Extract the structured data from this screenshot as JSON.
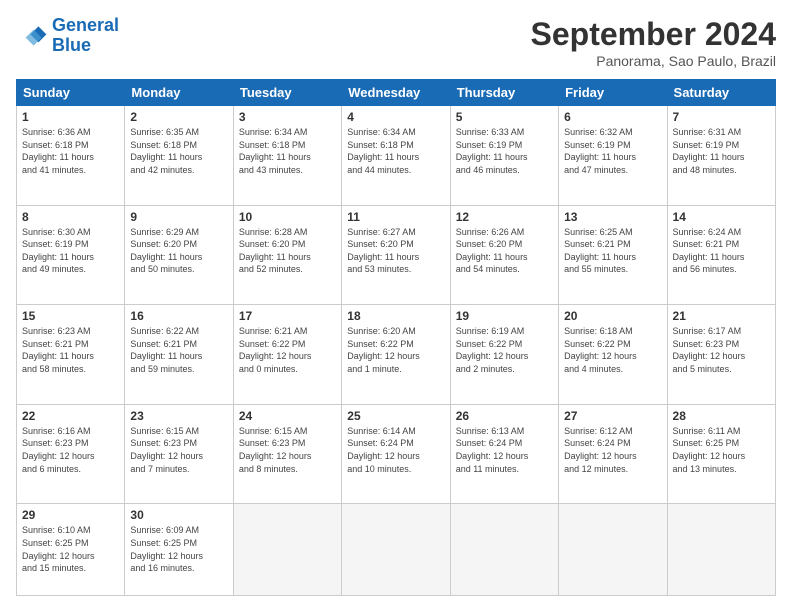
{
  "header": {
    "logo_line1": "General",
    "logo_line2": "Blue",
    "month_title": "September 2024",
    "location": "Panorama, Sao Paulo, Brazil"
  },
  "days_of_week": [
    "Sunday",
    "Monday",
    "Tuesday",
    "Wednesday",
    "Thursday",
    "Friday",
    "Saturday"
  ],
  "weeks": [
    [
      {
        "day": "1",
        "info": "Sunrise: 6:36 AM\nSunset: 6:18 PM\nDaylight: 11 hours\nand 41 minutes."
      },
      {
        "day": "2",
        "info": "Sunrise: 6:35 AM\nSunset: 6:18 PM\nDaylight: 11 hours\nand 42 minutes."
      },
      {
        "day": "3",
        "info": "Sunrise: 6:34 AM\nSunset: 6:18 PM\nDaylight: 11 hours\nand 43 minutes."
      },
      {
        "day": "4",
        "info": "Sunrise: 6:34 AM\nSunset: 6:18 PM\nDaylight: 11 hours\nand 44 minutes."
      },
      {
        "day": "5",
        "info": "Sunrise: 6:33 AM\nSunset: 6:19 PM\nDaylight: 11 hours\nand 46 minutes."
      },
      {
        "day": "6",
        "info": "Sunrise: 6:32 AM\nSunset: 6:19 PM\nDaylight: 11 hours\nand 47 minutes."
      },
      {
        "day": "7",
        "info": "Sunrise: 6:31 AM\nSunset: 6:19 PM\nDaylight: 11 hours\nand 48 minutes."
      }
    ],
    [
      {
        "day": "8",
        "info": "Sunrise: 6:30 AM\nSunset: 6:19 PM\nDaylight: 11 hours\nand 49 minutes."
      },
      {
        "day": "9",
        "info": "Sunrise: 6:29 AM\nSunset: 6:20 PM\nDaylight: 11 hours\nand 50 minutes."
      },
      {
        "day": "10",
        "info": "Sunrise: 6:28 AM\nSunset: 6:20 PM\nDaylight: 11 hours\nand 52 minutes."
      },
      {
        "day": "11",
        "info": "Sunrise: 6:27 AM\nSunset: 6:20 PM\nDaylight: 11 hours\nand 53 minutes."
      },
      {
        "day": "12",
        "info": "Sunrise: 6:26 AM\nSunset: 6:20 PM\nDaylight: 11 hours\nand 54 minutes."
      },
      {
        "day": "13",
        "info": "Sunrise: 6:25 AM\nSunset: 6:21 PM\nDaylight: 11 hours\nand 55 minutes."
      },
      {
        "day": "14",
        "info": "Sunrise: 6:24 AM\nSunset: 6:21 PM\nDaylight: 11 hours\nand 56 minutes."
      }
    ],
    [
      {
        "day": "15",
        "info": "Sunrise: 6:23 AM\nSunset: 6:21 PM\nDaylight: 11 hours\nand 58 minutes."
      },
      {
        "day": "16",
        "info": "Sunrise: 6:22 AM\nSunset: 6:21 PM\nDaylight: 11 hours\nand 59 minutes."
      },
      {
        "day": "17",
        "info": "Sunrise: 6:21 AM\nSunset: 6:22 PM\nDaylight: 12 hours\nand 0 minutes."
      },
      {
        "day": "18",
        "info": "Sunrise: 6:20 AM\nSunset: 6:22 PM\nDaylight: 12 hours\nand 1 minute."
      },
      {
        "day": "19",
        "info": "Sunrise: 6:19 AM\nSunset: 6:22 PM\nDaylight: 12 hours\nand 2 minutes."
      },
      {
        "day": "20",
        "info": "Sunrise: 6:18 AM\nSunset: 6:22 PM\nDaylight: 12 hours\nand 4 minutes."
      },
      {
        "day": "21",
        "info": "Sunrise: 6:17 AM\nSunset: 6:23 PM\nDaylight: 12 hours\nand 5 minutes."
      }
    ],
    [
      {
        "day": "22",
        "info": "Sunrise: 6:16 AM\nSunset: 6:23 PM\nDaylight: 12 hours\nand 6 minutes."
      },
      {
        "day": "23",
        "info": "Sunrise: 6:15 AM\nSunset: 6:23 PM\nDaylight: 12 hours\nand 7 minutes."
      },
      {
        "day": "24",
        "info": "Sunrise: 6:15 AM\nSunset: 6:23 PM\nDaylight: 12 hours\nand 8 minutes."
      },
      {
        "day": "25",
        "info": "Sunrise: 6:14 AM\nSunset: 6:24 PM\nDaylight: 12 hours\nand 10 minutes."
      },
      {
        "day": "26",
        "info": "Sunrise: 6:13 AM\nSunset: 6:24 PM\nDaylight: 12 hours\nand 11 minutes."
      },
      {
        "day": "27",
        "info": "Sunrise: 6:12 AM\nSunset: 6:24 PM\nDaylight: 12 hours\nand 12 minutes."
      },
      {
        "day": "28",
        "info": "Sunrise: 6:11 AM\nSunset: 6:25 PM\nDaylight: 12 hours\nand 13 minutes."
      }
    ],
    [
      {
        "day": "29",
        "info": "Sunrise: 6:10 AM\nSunset: 6:25 PM\nDaylight: 12 hours\nand 15 minutes."
      },
      {
        "day": "30",
        "info": "Sunrise: 6:09 AM\nSunset: 6:25 PM\nDaylight: 12 hours\nand 16 minutes."
      },
      {
        "day": "",
        "info": ""
      },
      {
        "day": "",
        "info": ""
      },
      {
        "day": "",
        "info": ""
      },
      {
        "day": "",
        "info": ""
      },
      {
        "day": "",
        "info": ""
      }
    ]
  ]
}
